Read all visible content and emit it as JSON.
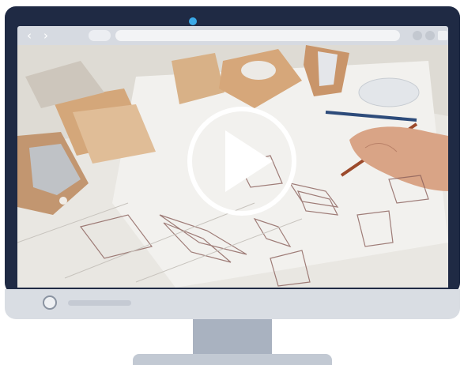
{
  "browser": {
    "back_icon": "chevron-left-icon",
    "forward_icon": "chevron-right-icon",
    "back_glyph": "‹",
    "forward_glyph": "›"
  },
  "video": {
    "play_icon": "play-icon"
  },
  "colors": {
    "bezel": "#1f2a44",
    "camera": "#3aa9e8",
    "chrome": "#d6dae1",
    "stand": "#a9b2c0"
  }
}
